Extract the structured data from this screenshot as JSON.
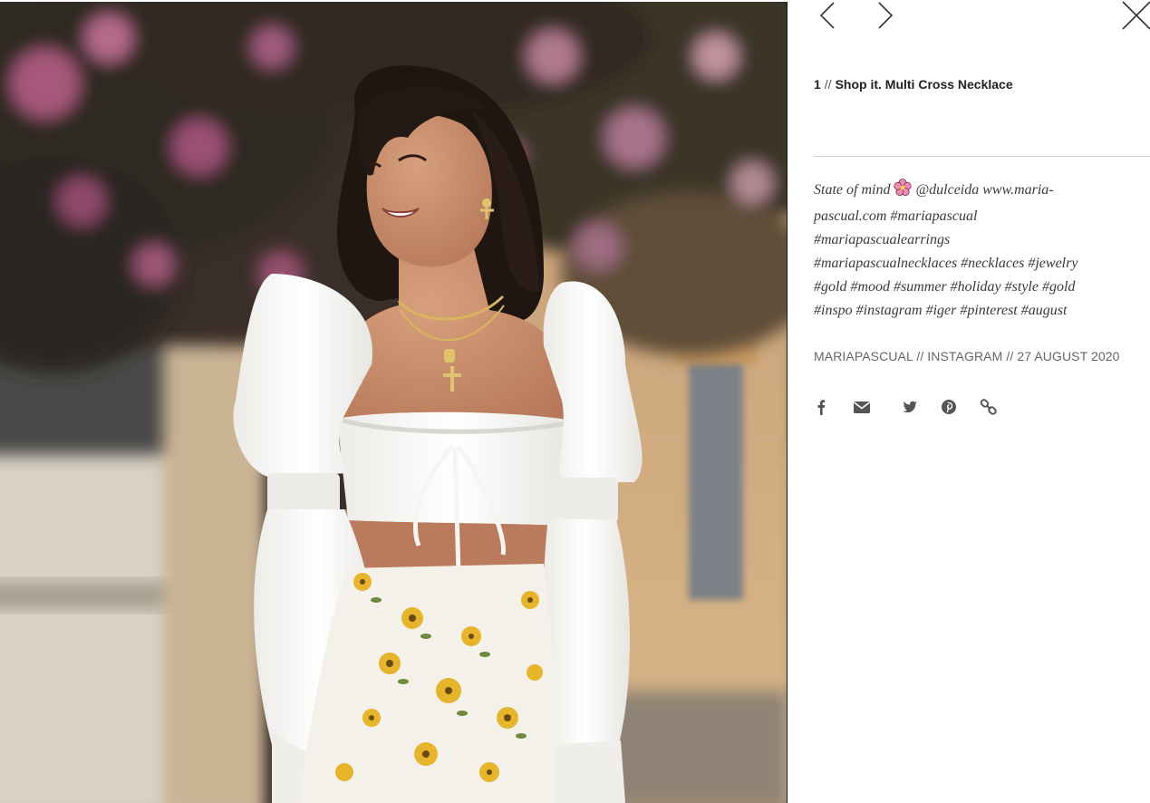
{
  "viewer": {
    "prev_icon": "chevron-left-icon",
    "next_icon": "chevron-right-icon",
    "close_icon": "close-icon",
    "accent_color": "#222222"
  },
  "post": {
    "index": "1",
    "separator": "//",
    "title": "Shop it. Multi Cross Necklace",
    "caption_lines": [
      {
        "before": "State of mind",
        "emoji": "flower-icon",
        "after": "@dulceida www.maria-"
      },
      {
        "text": "pascual.com #mariapascual"
      },
      {
        "text": "#mariapascualearrings"
      },
      {
        "text": "#mariapascualnecklaces #necklaces #jewelry"
      },
      {
        "text": "#gold #mood #summer #holiday #style #gold"
      },
      {
        "text": "#inspo #instagram #iger #pinterest #august"
      }
    ],
    "meta": "MARIAPASCUAL // INSTAGRAM // 27 AUGUST 2020"
  },
  "share": [
    {
      "name": "facebook-icon"
    },
    {
      "name": "email-icon"
    },
    {
      "name": "twitter-icon"
    },
    {
      "name": "pinterest-icon"
    },
    {
      "name": "link-icon"
    }
  ],
  "photo": {
    "subject": "woman-in-white-top-photo"
  }
}
